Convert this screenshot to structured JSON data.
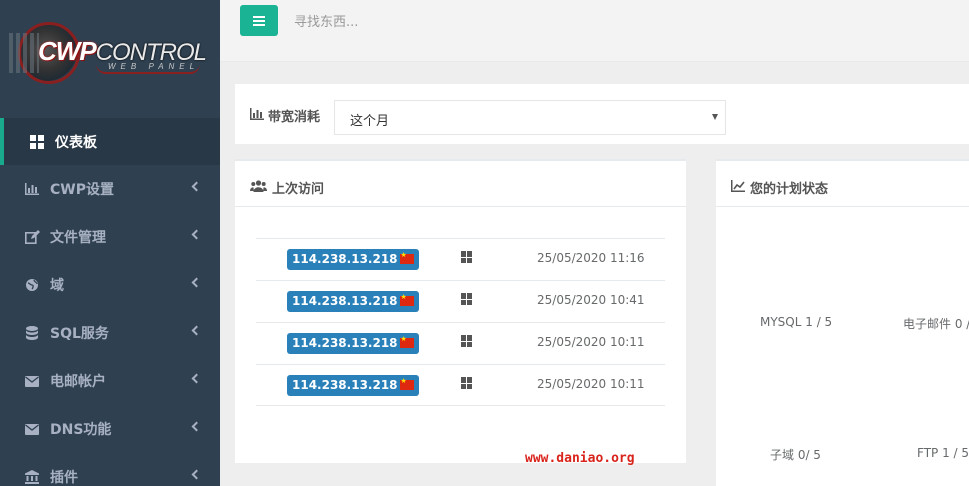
{
  "logo": {
    "main_left": "CWP",
    "main_right": "CONTROL",
    "sub": "WEB PANEL"
  },
  "topbar": {
    "search_placeholder": "寻找东西..."
  },
  "sidebar": {
    "items": [
      {
        "label": "仪表板",
        "icon": "dashboard-grid-icon",
        "active": true
      },
      {
        "label": "CWP设置",
        "icon": "bar-chart-icon",
        "active": false
      },
      {
        "label": "文件管理",
        "icon": "edit-icon",
        "active": false
      },
      {
        "label": "域",
        "icon": "globe-icon",
        "active": false
      },
      {
        "label": "SQL服务",
        "icon": "database-icon",
        "active": false
      },
      {
        "label": "电邮帐户",
        "icon": "envelope-icon",
        "active": false
      },
      {
        "label": "DNS功能",
        "icon": "envelope-icon",
        "active": false
      },
      {
        "label": "插件",
        "icon": "bank-icon",
        "active": false
      }
    ]
  },
  "bandwidth": {
    "label": "带宽消耗",
    "selected": "这个月"
  },
  "visits": {
    "title": "上次访问",
    "rows": [
      {
        "ip": "114.238.13.218",
        "date": "25/05/2020 11:16"
      },
      {
        "ip": "114.238.13.218",
        "date": "25/05/2020 10:41"
      },
      {
        "ip": "114.238.13.218",
        "date": "25/05/2020 10:11"
      },
      {
        "ip": "114.238.13.218",
        "date": "25/05/2020 10:11"
      }
    ]
  },
  "plan": {
    "title": "您的计划状态",
    "mysql": "MYSQL 1 / 5",
    "email": "电子邮件 0 /",
    "subdomain": "子域 0/ 5",
    "ftp": "FTP 1 / 5"
  },
  "watermark": "www.daniao.org",
  "colors": {
    "sidebar": "#2f4050",
    "accent": "#1ab394",
    "badge": "#2a80b9"
  }
}
